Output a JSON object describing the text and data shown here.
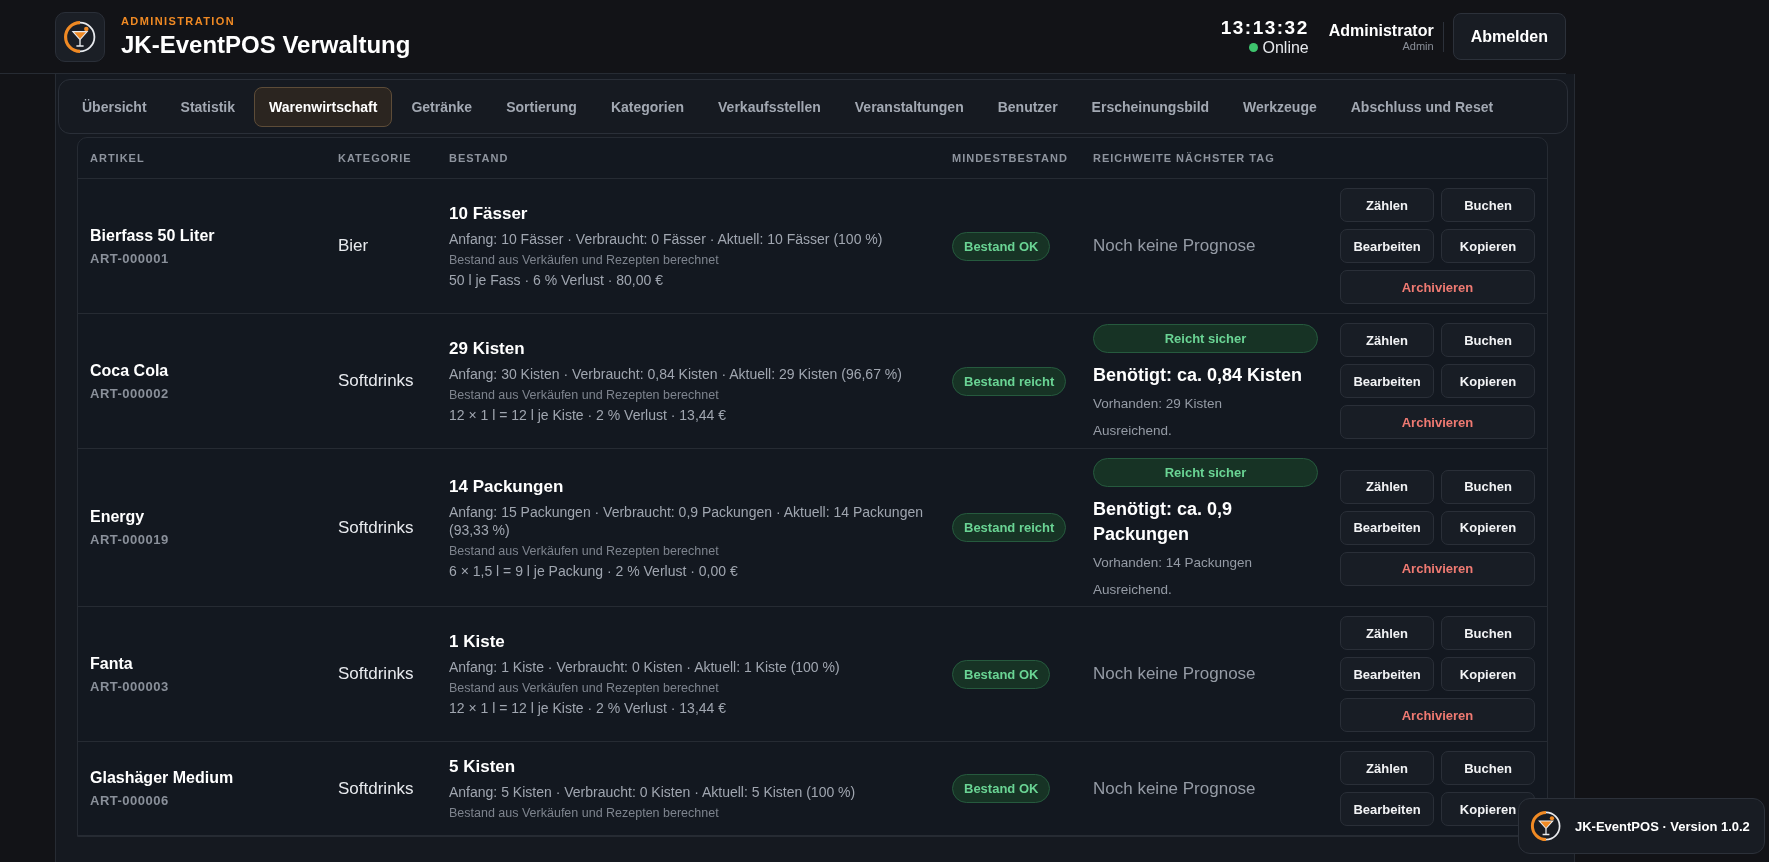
{
  "header": {
    "eyebrow": "ADMINISTRATION",
    "title": "JK-EventPOS Verwaltung",
    "clock": "13:13:32",
    "status": {
      "label": "Online",
      "online": true
    },
    "user": {
      "name": "Administrator",
      "role": "Admin"
    },
    "logout": "Abmelden"
  },
  "tabs": [
    {
      "label": "Übersicht",
      "selected": false
    },
    {
      "label": "Statistik",
      "selected": false
    },
    {
      "label": "Warenwirtschaft",
      "selected": true
    },
    {
      "label": "Getränke",
      "selected": false
    },
    {
      "label": "Sortierung",
      "selected": false
    },
    {
      "label": "Kategorien",
      "selected": false
    },
    {
      "label": "Verkaufsstellen",
      "selected": false
    },
    {
      "label": "Veranstaltungen",
      "selected": false
    },
    {
      "label": "Benutzer",
      "selected": false
    },
    {
      "label": "Erscheinungsbild",
      "selected": false
    },
    {
      "label": "Werkzeuge",
      "selected": false
    },
    {
      "label": "Abschluss und Reset",
      "selected": false
    }
  ],
  "table": {
    "columns": [
      "ARTIKEL",
      "KATEGORIE",
      "BESTAND",
      "MINDESTBESTAND",
      "REICHWEITE NÄCHSTER TAG"
    ],
    "rows": [
      {
        "name": "Bierfass 50 Liter",
        "code": "ART-000001",
        "category": "Bier",
        "stock": {
          "title": "10 Fässer",
          "detail": "Anfang: 10 Fässer · Verbraucht: 0 Fässer · Aktuell: 10 Fässer (100 %)",
          "source": "Bestand aus Verkäufen und Rezepten berechnet",
          "pack": "50 l je Fass · 6 % Verlust · 80,00 €"
        },
        "minimum": "Bestand OK",
        "forecast": {
          "kind": "none",
          "text": "Noch keine Prognose"
        },
        "actions": [
          {
            "label": "Zählen",
            "kind": "default"
          },
          {
            "label": "Buchen",
            "kind": "default"
          },
          {
            "label": "Bearbeiten",
            "kind": "default"
          },
          {
            "label": "Kopieren",
            "kind": "default"
          },
          {
            "label": "Archivieren",
            "kind": "danger"
          }
        ]
      },
      {
        "name": "Coca Cola",
        "code": "ART-000002",
        "category": "Softdrinks",
        "stock": {
          "title": "29 Kisten",
          "detail": "Anfang: 30 Kisten · Verbraucht: 0,84 Kisten · Aktuell: 29 Kisten (96,67 %)",
          "source": "Bestand aus Verkäufen und Rezepten berechnet",
          "pack": "12 × 1 l = 12 l je Kiste · 2 % Verlust · 13,44 €"
        },
        "minimum": "Bestand reicht",
        "forecast": {
          "kind": "estimate",
          "badge": "Reicht sicher",
          "need": "Benötigt: ca. 0,84 Kisten",
          "available": "Vorhanden: 29 Kisten",
          "verdict": "Ausreichend."
        },
        "actions": [
          {
            "label": "Zählen",
            "kind": "default"
          },
          {
            "label": "Buchen",
            "kind": "default"
          },
          {
            "label": "Bearbeiten",
            "kind": "default"
          },
          {
            "label": "Kopieren",
            "kind": "default"
          },
          {
            "label": "Archivieren",
            "kind": "danger"
          }
        ]
      },
      {
        "name": "Energy",
        "code": "ART-000019",
        "category": "Softdrinks",
        "stock": {
          "title": "14 Packungen",
          "detail": "Anfang: 15 Packungen · Verbraucht: 0,9 Packungen · Aktuell: 14 Packungen (93,33 %)",
          "source": "Bestand aus Verkäufen und Rezepten berechnet",
          "pack": "6 × 1,5 l = 9 l je Packung · 2 % Verlust · 0,00 €"
        },
        "minimum": "Bestand reicht",
        "forecast": {
          "kind": "estimate",
          "badge": "Reicht sicher",
          "need": "Benötigt: ca. 0,9 Packungen",
          "available": "Vorhanden: 14 Packungen",
          "verdict": "Ausreichend."
        },
        "actions": [
          {
            "label": "Zählen",
            "kind": "default"
          },
          {
            "label": "Buchen",
            "kind": "default"
          },
          {
            "label": "Bearbeiten",
            "kind": "default"
          },
          {
            "label": "Kopieren",
            "kind": "default"
          },
          {
            "label": "Archivieren",
            "kind": "danger"
          }
        ]
      },
      {
        "name": "Fanta",
        "code": "ART-000003",
        "category": "Softdrinks",
        "stock": {
          "title": "1 Kiste",
          "detail": "Anfang: 1 Kiste · Verbraucht: 0 Kisten · Aktuell: 1 Kiste (100 %)",
          "source": "Bestand aus Verkäufen und Rezepten berechnet",
          "pack": "12 × 1 l = 12 l je Kiste · 2 % Verlust · 13,44 €"
        },
        "minimum": "Bestand OK",
        "forecast": {
          "kind": "none",
          "text": "Noch keine Prognose"
        },
        "actions": [
          {
            "label": "Zählen",
            "kind": "default"
          },
          {
            "label": "Buchen",
            "kind": "default"
          },
          {
            "label": "Bearbeiten",
            "kind": "default"
          },
          {
            "label": "Kopieren",
            "kind": "default"
          },
          {
            "label": "Archivieren",
            "kind": "danger"
          }
        ]
      },
      {
        "name": "Glashäger Medium",
        "code": "ART-000006",
        "category": "Softdrinks",
        "stock": {
          "title": "5 Kisten",
          "detail": "Anfang: 5 Kisten · Verbraucht: 0 Kisten · Aktuell: 5 Kisten (100 %)",
          "source": "Bestand aus Verkäufen und Rezepten berechnet"
        },
        "minimum": "Bestand OK",
        "forecast": {
          "kind": "none",
          "text": "Noch keine Prognose"
        },
        "actions": [
          {
            "label": "Zählen",
            "kind": "default"
          },
          {
            "label": "Buchen",
            "kind": "default"
          },
          {
            "label": "Bearbeiten",
            "kind": "default"
          },
          {
            "label": "Kopieren",
            "kind": "default"
          }
        ]
      }
    ]
  },
  "version_badge": "JK-EventPOS · Version 1.0.2"
}
